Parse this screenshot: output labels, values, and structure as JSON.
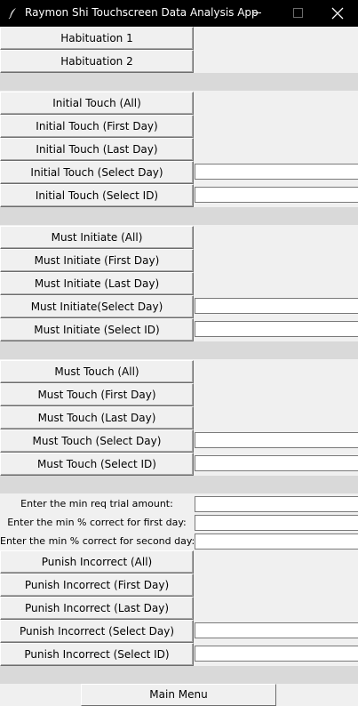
{
  "window": {
    "title": "Raymon Shi Touchscreen Data Analysis App"
  },
  "habituation": {
    "b1": "Habituation 1",
    "b2": "Habituation 2"
  },
  "initial_touch": {
    "all": "Initial Touch (All)",
    "first_day": "Initial Touch (First Day)",
    "last_day": "Initial Touch (Last Day)",
    "select_day": "Initial Touch (Select Day)",
    "select_id": "Initial Touch (Select ID)",
    "select_day_value": "",
    "select_id_value": ""
  },
  "must_initiate": {
    "all": "Must Initiate (All)",
    "first_day": "Must Initiate (First Day)",
    "last_day": "Must Initiate (Last Day)",
    "select_day": "Must Initiate(Select Day)",
    "select_id": "Must Initiate (Select ID)",
    "select_day_value": "",
    "select_id_value": ""
  },
  "must_touch": {
    "all": "Must Touch (All)",
    "first_day": "Must Touch (First Day)",
    "last_day": "Must Touch (Last Day)",
    "select_day": "Must Touch (Select Day)",
    "select_id": "Must Touch (Select ID)",
    "select_day_value": "",
    "select_id_value": ""
  },
  "criteria": {
    "min_trials_label": "Enter the min req trial amount:",
    "min_pct_first_label": "Enter the min % correct for first day:",
    "min_pct_second_label": "Enter the min % correct for second day:",
    "min_trials_value": "",
    "min_pct_first_value": "",
    "min_pct_second_value": ""
  },
  "punish_incorrect": {
    "all": "Punish Incorrect (All)",
    "first_day": "Punish Incorrect (First Day)",
    "last_day": "Punish Incorrect (Last Day)",
    "select_day": "Punish Incorrect (Select Day)",
    "select_id": "Punish Incorrect (Select ID)",
    "select_day_value": "",
    "select_id_value": ""
  },
  "footer": {
    "main_menu": "Main Menu"
  }
}
